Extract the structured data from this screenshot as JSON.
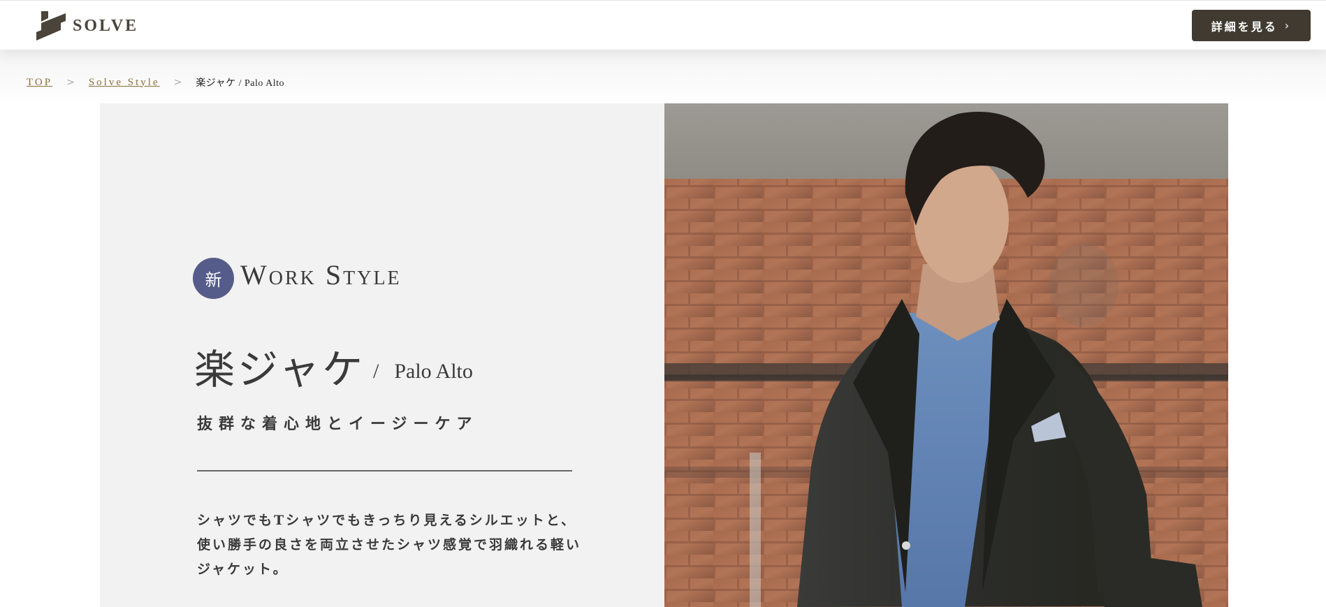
{
  "header": {
    "logo_text": "SOLVE",
    "detail_button_label": "詳細を見る",
    "detail_button_chevron": "›"
  },
  "breadcrumb": {
    "items": [
      {
        "label": "TOP",
        "link": true
      },
      {
        "label": "Solve Style",
        "link": true
      },
      {
        "label": "楽ジャケ / Palo Alto",
        "link": false
      }
    ],
    "separator": ">"
  },
  "hero": {
    "badge": "新",
    "category": "Work Style",
    "title": "楽ジャケ",
    "slash": "/",
    "subtitle": "Palo Alto",
    "tagline": "抜群な着心地とイージーケア",
    "description_lines": [
      "シャツでもTシャツでもきっちり見えるシルエットと、",
      "使い勝手の良さを両立させたシャツ感覚で羽織れる軽い",
      "ジャケット。"
    ]
  },
  "colors": {
    "brand_dark": "#403a30",
    "link_gold": "#8a6e3c",
    "badge_indigo": "#565c8a",
    "panel_gray": "#f2f2f2"
  },
  "icons": [
    "solve-logo-icon",
    "chevron-right-icon"
  ]
}
